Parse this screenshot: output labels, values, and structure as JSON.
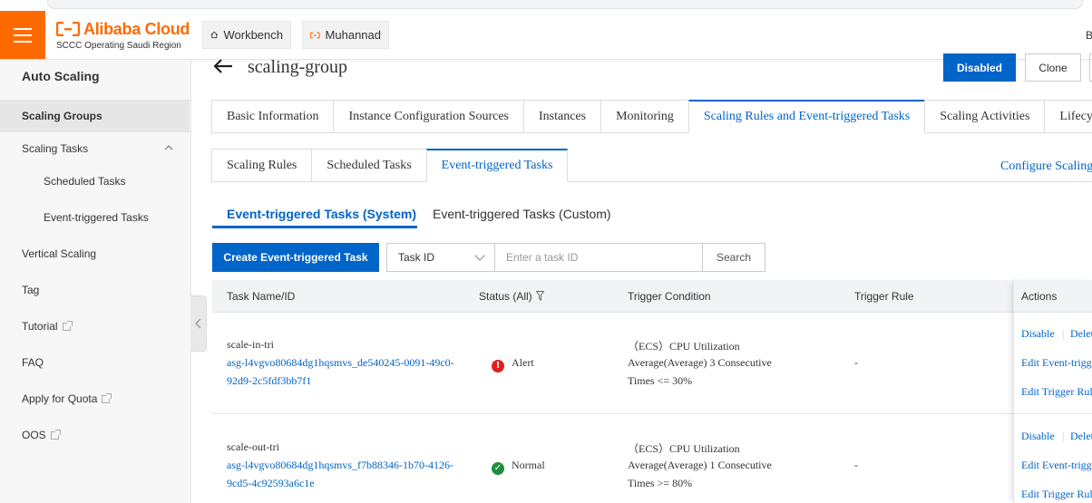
{
  "topbar": {
    "brand": "Alibaba Cloud",
    "region": "SCCC Operating Saudi Region",
    "tabs": [
      {
        "label": "Workbench",
        "icon": "home-icon"
      },
      {
        "label": "Muhannad",
        "icon": "alibaba-bracket-icon"
      }
    ],
    "user_initial": "B"
  },
  "sidebar": {
    "title": "Auto Scaling",
    "items": [
      {
        "label": "Scaling Groups",
        "active": true
      },
      {
        "label": "Scaling Tasks",
        "expanded": true
      },
      {
        "label": "Scheduled Tasks",
        "child": true
      },
      {
        "label": "Event-triggered Tasks",
        "child": true
      },
      {
        "label": "Vertical Scaling"
      },
      {
        "label": "Tag"
      },
      {
        "label": "Tutorial",
        "external": true
      },
      {
        "label": "FAQ"
      },
      {
        "label": "Apply for Quota",
        "external": true
      },
      {
        "label": "OOS",
        "external": true
      }
    ]
  },
  "page": {
    "title": "scaling-group",
    "buttons": {
      "disabled": "Disabled",
      "clone": "Clone"
    }
  },
  "main_tabs": [
    "Basic Information",
    "Instance Configuration Sources",
    "Instances",
    "Monitoring",
    "Scaling Rules and Event-triggered Tasks",
    "Scaling Activities",
    "Lifecycle"
  ],
  "sub_tabs": [
    "Scaling Rules",
    "Scheduled Tasks",
    "Event-triggered Tasks"
  ],
  "configure_link": "Configure Scaling",
  "inner_tabs": [
    "Event-triggered Tasks (System)",
    "Event-triggered Tasks (Custom)"
  ],
  "toolbar": {
    "create_label": "Create Event-triggered Task",
    "select_value": "Task ID",
    "search_placeholder": "Enter a task ID",
    "search_label": "Search"
  },
  "table": {
    "headers": [
      "Task Name/ID",
      "Status (All)",
      "Trigger Condition",
      "Trigger Rule",
      "Actions"
    ],
    "rows": [
      {
        "name": "scale-in-tri",
        "id_line1": "asg-l4vgvo80684dg1hqsmvs_de540245-0091-49c0-",
        "id_line2": "92d9-2c5fdf3bb7f1",
        "status": "Alert",
        "cond_line1": "（ECS）CPU Utilization",
        "cond_line2": "Average(Average) 3 Consecutive",
        "cond_line3": "Times <= 30%",
        "rule": "-",
        "action_disable": "Disable",
        "action_delete": "Delete",
        "action_edit_task": "Edit Event-triggered Task",
        "action_edit_rule": "Edit Trigger Rule"
      },
      {
        "name": "scale-out-tri",
        "id_line1": "asg-l4vgvo80684dg1hqsmvs_f7b88346-1b70-4126-",
        "id_line2": "9cd5-4c92593a6c1e",
        "status": "Normal",
        "cond_line1": "（ECS）CPU Utilization",
        "cond_line2": "Average(Average) 1 Consecutive",
        "cond_line3": "Times >= 80%",
        "rule": "-",
        "action_disable": "Disable",
        "action_delete": "Delete",
        "action_edit_task": "Edit Event-triggered Task",
        "action_edit_rule": "Edit Trigger Rule"
      }
    ]
  }
}
